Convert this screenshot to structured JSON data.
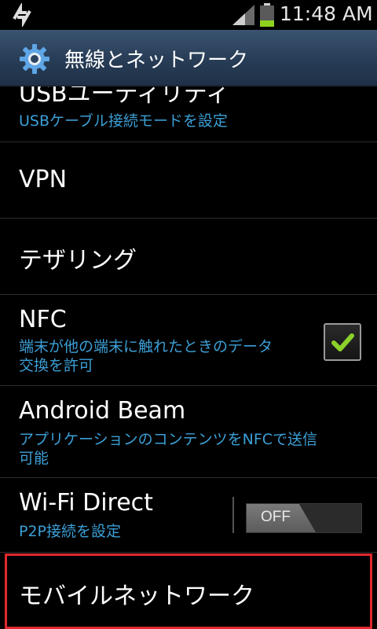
{
  "status_bar": {
    "time": "11:48 AM"
  },
  "title_bar": {
    "title": "無線とネットワーク",
    "icon": "gear-icon"
  },
  "items": {
    "usb": {
      "title": "USBユーティリティ",
      "subtitle": "USBケーブル接続モードを設定"
    },
    "vpn": {
      "title": "VPN"
    },
    "tethering": {
      "title": "テザリング"
    },
    "nfc": {
      "title": "NFC",
      "subtitle_line1": "端末が他の端末に触れたときのデータ",
      "subtitle_line2": "交換を許可",
      "checked": true
    },
    "android_beam": {
      "title": "Android Beam",
      "subtitle_line1": "アプリケーションのコンテンツをNFCで送信",
      "subtitle_line2": "可能"
    },
    "wifi_direct": {
      "title": "Wi-Fi Direct",
      "subtitle": "P2P接続を設定",
      "toggle_label": "OFF"
    },
    "mobile_network": {
      "title": "モバイルネットワーク"
    }
  },
  "colors": {
    "accent_blue": "#3c9fd6",
    "check_green": "#8bd12a",
    "highlight_red": "#e0282e",
    "title_bar": "#2c4460"
  }
}
